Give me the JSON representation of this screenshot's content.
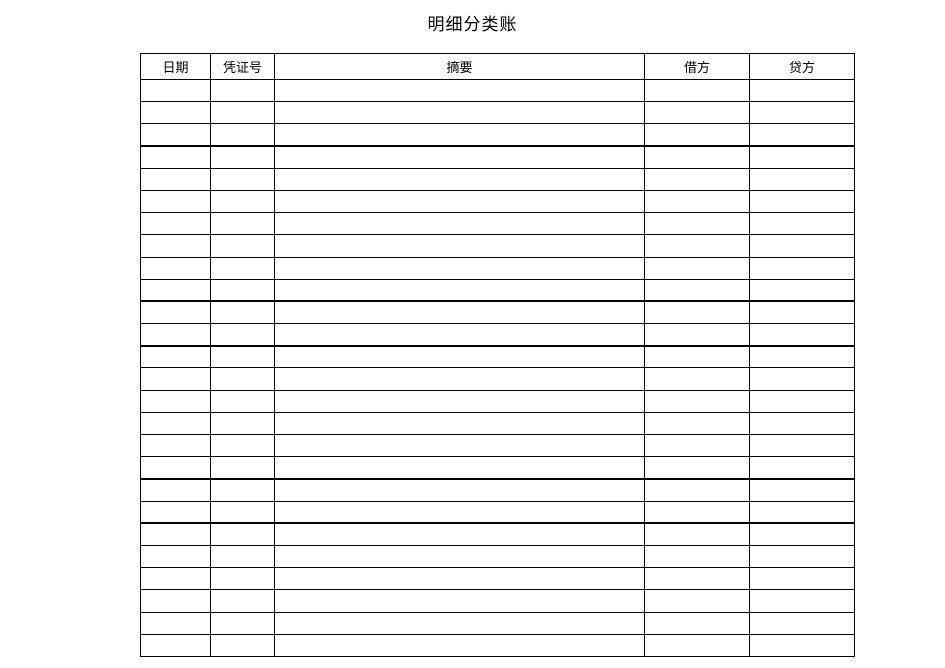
{
  "title": "明细分类账",
  "columns": {
    "date": "日期",
    "voucher": "凭证号",
    "summary": "摘要",
    "debit": "借方",
    "credit": "贷方"
  },
  "rows": [
    {
      "date": "",
      "voucher": "",
      "summary": "",
      "debit": "",
      "credit": ""
    },
    {
      "date": "",
      "voucher": "",
      "summary": "",
      "debit": "",
      "credit": ""
    },
    {
      "date": "",
      "voucher": "",
      "summary": "",
      "debit": "",
      "credit": ""
    },
    {
      "date": "",
      "voucher": "",
      "summary": "",
      "debit": "",
      "credit": ""
    },
    {
      "date": "",
      "voucher": "",
      "summary": "",
      "debit": "",
      "credit": ""
    },
    {
      "date": "",
      "voucher": "",
      "summary": "",
      "debit": "",
      "credit": ""
    },
    {
      "date": "",
      "voucher": "",
      "summary": "",
      "debit": "",
      "credit": ""
    },
    {
      "date": "",
      "voucher": "",
      "summary": "",
      "debit": "",
      "credit": ""
    },
    {
      "date": "",
      "voucher": "",
      "summary": "",
      "debit": "",
      "credit": ""
    },
    {
      "date": "",
      "voucher": "",
      "summary": "",
      "debit": "",
      "credit": ""
    },
    {
      "date": "",
      "voucher": "",
      "summary": "",
      "debit": "",
      "credit": ""
    },
    {
      "date": "",
      "voucher": "",
      "summary": "",
      "debit": "",
      "credit": ""
    },
    {
      "date": "",
      "voucher": "",
      "summary": "",
      "debit": "",
      "credit": ""
    },
    {
      "date": "",
      "voucher": "",
      "summary": "",
      "debit": "",
      "credit": ""
    },
    {
      "date": "",
      "voucher": "",
      "summary": "",
      "debit": "",
      "credit": ""
    },
    {
      "date": "",
      "voucher": "",
      "summary": "",
      "debit": "",
      "credit": ""
    },
    {
      "date": "",
      "voucher": "",
      "summary": "",
      "debit": "",
      "credit": ""
    },
    {
      "date": "",
      "voucher": "",
      "summary": "",
      "debit": "",
      "credit": ""
    },
    {
      "date": "",
      "voucher": "",
      "summary": "",
      "debit": "",
      "credit": ""
    },
    {
      "date": "",
      "voucher": "",
      "summary": "",
      "debit": "",
      "credit": ""
    },
    {
      "date": "",
      "voucher": "",
      "summary": "",
      "debit": "",
      "credit": ""
    },
    {
      "date": "",
      "voucher": "",
      "summary": "",
      "debit": "",
      "credit": ""
    },
    {
      "date": "",
      "voucher": "",
      "summary": "",
      "debit": "",
      "credit": ""
    },
    {
      "date": "",
      "voucher": "",
      "summary": "",
      "debit": "",
      "credit": ""
    },
    {
      "date": "",
      "voucher": "",
      "summary": "",
      "debit": "",
      "credit": ""
    },
    {
      "date": "",
      "voucher": "",
      "summary": "",
      "debit": "",
      "credit": ""
    }
  ],
  "heavy_divider_after_rows": [
    3,
    10,
    12,
    18,
    20
  ]
}
